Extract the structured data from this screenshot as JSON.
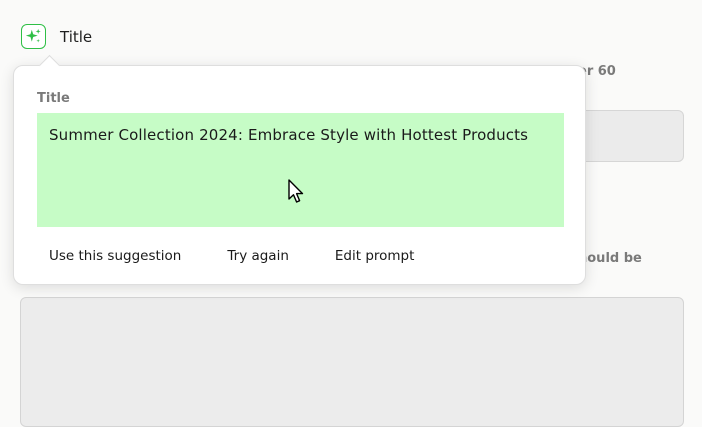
{
  "field": {
    "label": "Title",
    "icon": "sparkles-icon",
    "accent_color": "#2fbf46"
  },
  "background": {
    "hint_top": "er 60",
    "hint_mid": "hould be"
  },
  "popover": {
    "title": "Title",
    "suggestion": "Summer Collection 2024: Embrace Style with Hottest Products",
    "suggestion_bg": "#c6fcc6",
    "actions": {
      "use": "Use this suggestion",
      "retry": "Try again",
      "edit": "Edit prompt"
    }
  }
}
